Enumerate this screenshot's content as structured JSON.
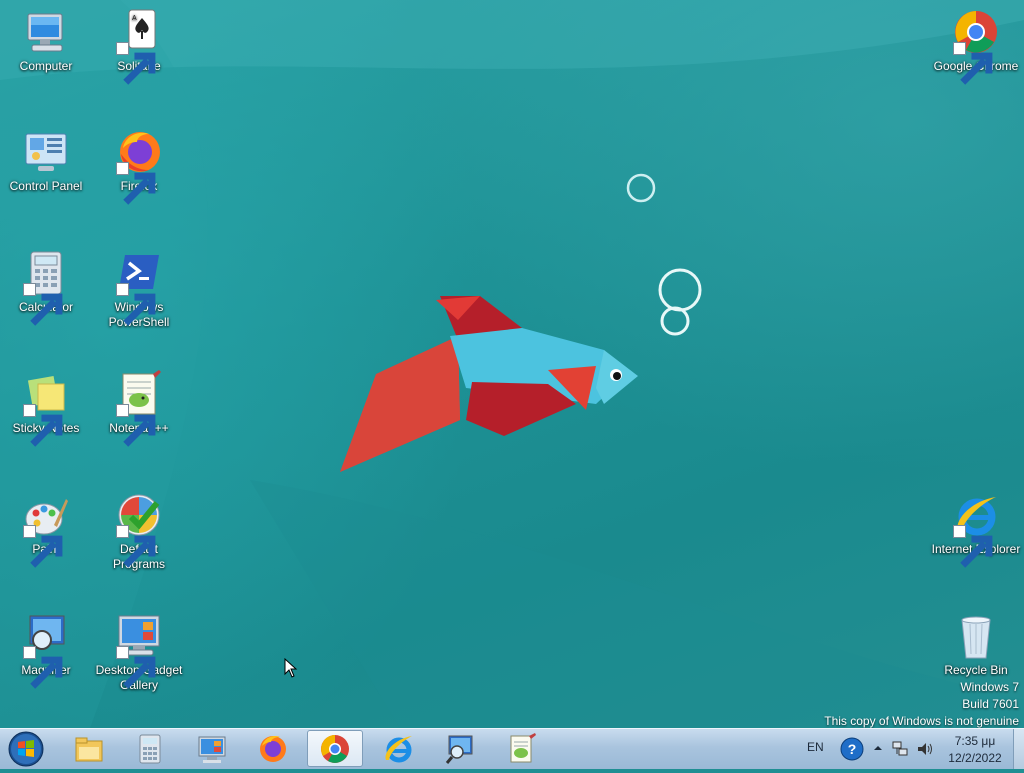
{
  "desktop": {
    "icons": {
      "computer": "Computer",
      "solitaire": "Solitaire",
      "chrome": "Google Chrome",
      "control_panel": "Control Panel",
      "firefox": "Firefox",
      "calculator": "Calculator",
      "powershell": "Windows PowerShell",
      "sticky_notes": "Sticky Notes",
      "notepadpp": "Notepad++",
      "paint": "Paint",
      "default_programs": "Default Programs",
      "ie": "Internet Explorer",
      "magnifier": "Magnifier",
      "gadget_gallery": "Desktop Gadget Gallery",
      "recycle_bin": "Recycle Bin"
    },
    "watermark": {
      "line1": "Windows 7",
      "line2": "Build 7601",
      "line3": "This copy of Windows is not genuine"
    }
  },
  "taskbar": {
    "pinned": [
      "explorer-icon",
      "calculator-icon",
      "remote-desktop-icon",
      "firefox-icon",
      "chrome-icon",
      "internet-explorer-icon",
      "magnifier-icon",
      "notepadpp-icon"
    ],
    "active_app": "chrome-icon",
    "tray": {
      "language": "EN",
      "time": "7:35 μμ",
      "date": "12/2/2022"
    }
  },
  "colors": {
    "wallpaper": "#1f8f93",
    "taskbar": "#a9c4de",
    "fish_body": "#4cc3df",
    "fish_fin": "#b51f2a"
  }
}
